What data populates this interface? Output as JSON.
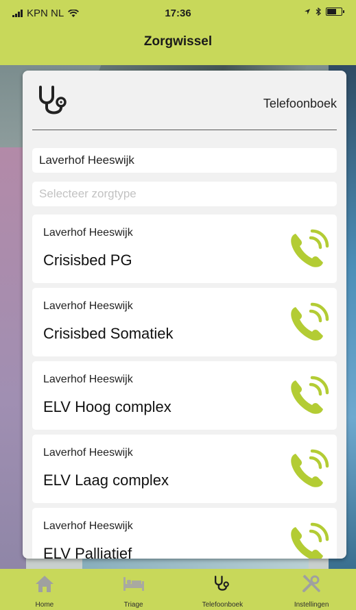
{
  "status": {
    "carrier": "KPN NL",
    "time": "17:36"
  },
  "header": {
    "title": "Zorgwissel"
  },
  "card": {
    "title": "Telefoonboek",
    "location_value": "Laverhof Heeswijk",
    "type_placeholder": "Selecteer zorgtype"
  },
  "items": [
    {
      "location": "Laverhof Heeswijk",
      "name": "Crisisbed PG"
    },
    {
      "location": "Laverhof Heeswijk",
      "name": "Crisisbed Somatiek"
    },
    {
      "location": "Laverhof Heeswijk",
      "name": "ELV Hoog complex"
    },
    {
      "location": "Laverhof Heeswijk",
      "name": "ELV Laag complex"
    },
    {
      "location": "Laverhof Heeswijk",
      "name": "ELV Palliatief"
    }
  ],
  "tabs": [
    {
      "label": "Home",
      "icon": "home-icon",
      "active": false
    },
    {
      "label": "Triage",
      "icon": "bed-icon",
      "active": false
    },
    {
      "label": "Telefoonboek",
      "icon": "stethoscope-icon",
      "active": true
    },
    {
      "label": "Instellingen",
      "icon": "tools-icon",
      "active": false
    }
  ],
  "colors": {
    "accent": "#c8d85a",
    "call_green": "#b3cc34"
  }
}
